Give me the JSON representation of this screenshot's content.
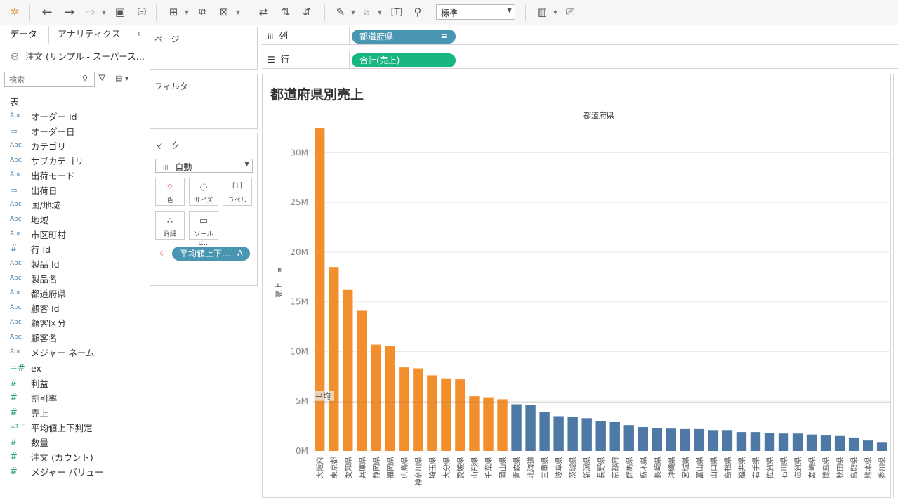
{
  "toolbar": {
    "icons": [
      "tableau-logo-icon",
      "undo-icon",
      "redo-icon",
      "replay-icon",
      "save-icon",
      "new-datasource-icon",
      "new-worksheet-icon",
      "duplicate-sheet-icon",
      "clear-sheet-icon",
      "swap-icon",
      "sort-ascending-icon",
      "sort-descending-icon",
      "highlight-icon",
      "group-icon",
      "label-icon",
      "pin-icon",
      "show-me-icon",
      "presentation-icon"
    ],
    "fit": "標準"
  },
  "datapane": {
    "tab_data": "データ",
    "tab_analytics": "アナリティクス",
    "datasource": "注文 (サンプル - スーパース…",
    "search_placeholder": "検索",
    "section_title": "表",
    "dimensions": [
      {
        "type": "Abc",
        "name": "オーダー Id"
      },
      {
        "type": "date",
        "name": "オーダー日"
      },
      {
        "type": "Abc",
        "name": "カテゴリ"
      },
      {
        "type": "Abc",
        "name": "サブカテゴリ"
      },
      {
        "type": "Abc",
        "name": "出荷モード"
      },
      {
        "type": "date",
        "name": "出荷日"
      },
      {
        "type": "Abc",
        "name": "国/地域"
      },
      {
        "type": "Abc",
        "name": "地域"
      },
      {
        "type": "Abc",
        "name": "市区町村"
      },
      {
        "type": "#",
        "name": "行 Id"
      },
      {
        "type": "Abc",
        "name": "製品 Id"
      },
      {
        "type": "Abc",
        "name": "製品名"
      },
      {
        "type": "Abc",
        "name": "都道府県"
      },
      {
        "type": "Abc",
        "name": "顧客 Id"
      },
      {
        "type": "Abc",
        "name": "顧客区分"
      },
      {
        "type": "Abc",
        "name": "顧客名"
      },
      {
        "type": "Abc",
        "name": "メジャー ネーム"
      }
    ],
    "measures": [
      {
        "type": "=#",
        "name": "ex"
      },
      {
        "type": "#",
        "name": "利益"
      },
      {
        "type": "#",
        "name": "割引率"
      },
      {
        "type": "#",
        "name": "売上"
      },
      {
        "type": "=T|F",
        "name": "平均値上下判定"
      },
      {
        "type": "#",
        "name": "数量"
      },
      {
        "type": "#",
        "name": "注文 (カウント)"
      },
      {
        "type": "#",
        "name": "メジャー バリュー"
      }
    ]
  },
  "cards": {
    "pages": "ページ",
    "filters": "フィルター",
    "marks": "マーク",
    "marks_type": "自動",
    "mark_buttons": [
      "色",
      "サイズ",
      "ラベル",
      "詳細",
      "ツールヒ…"
    ],
    "color_pill": "平均値上下…",
    "color_pill_delta": "Δ"
  },
  "shelves": {
    "columns_label": "列",
    "rows_label": "行",
    "columns_pill": "都道府県",
    "rows_pill": "合計(売上)"
  },
  "view": {
    "title": "都道府県別売上"
  },
  "chart_data": {
    "type": "bar",
    "header": "都道府県",
    "ylabel": "売上",
    "ylim": [
      0,
      33000000
    ],
    "yticks": [
      0,
      5000000,
      10000000,
      15000000,
      20000000,
      25000000,
      30000000
    ],
    "ytick_labels": [
      "0M",
      "5M",
      "10M",
      "15M",
      "20M",
      "25M",
      "30M"
    ],
    "reference_line": {
      "label": "平均",
      "value": 4900000
    },
    "colors": {
      "above": "#f28e2b",
      "below": "#4e79a7"
    },
    "categories": [
      "大阪府",
      "東京都",
      "愛知県",
      "兵庫県",
      "静岡県",
      "福岡県",
      "広島県",
      "神奈川県",
      "埼玉県",
      "大分県",
      "愛媛県",
      "山形県",
      "千葉県",
      "岡山県",
      "青森県",
      "北海道",
      "三重県",
      "岐阜県",
      "茨城県",
      "新潟県",
      "長野県",
      "京都府",
      "群馬県",
      "栃木県",
      "長崎県",
      "沖縄県",
      "宮城県",
      "富山県",
      "山口県",
      "島根県",
      "福井県",
      "岩手県",
      "佐賀県",
      "石川県",
      "滋賀県",
      "宮崎県",
      "徳島県",
      "秋田県",
      "鳥取県",
      "熊本県",
      "香川県"
    ],
    "values": [
      32500000,
      18500000,
      16200000,
      14100000,
      10700000,
      10600000,
      8400000,
      8300000,
      7600000,
      7300000,
      7200000,
      5500000,
      5400000,
      5200000,
      4700000,
      4600000,
      3900000,
      3500000,
      3400000,
      3300000,
      3000000,
      2900000,
      2600000,
      2400000,
      2300000,
      2250000,
      2200000,
      2200000,
      2100000,
      2100000,
      1900000,
      1900000,
      1800000,
      1750000,
      1750000,
      1650000,
      1550000,
      1500000,
      1350000,
      1050000,
      900000
    ]
  }
}
